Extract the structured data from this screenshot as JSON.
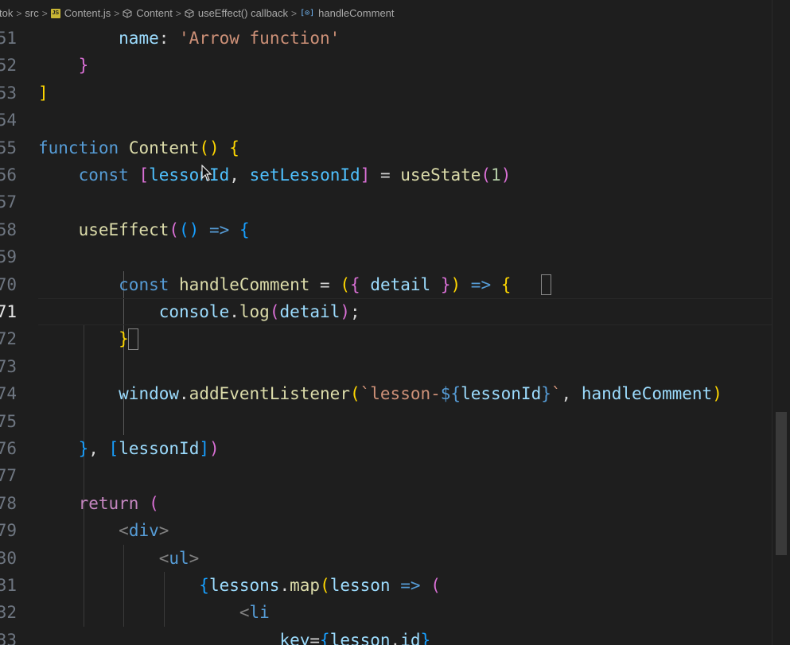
{
  "breadcrumb": [
    {
      "label": "tok",
      "icon": null
    },
    {
      "label": "src",
      "icon": null
    },
    {
      "label": "Content.js",
      "icon": "js-file-icon"
    },
    {
      "label": "Content",
      "icon": "symbol-cube-icon"
    },
    {
      "label": "useEffect() callback",
      "icon": "symbol-cube-icon"
    },
    {
      "label": "handleComment",
      "icon": "symbol-variable-icon"
    }
  ],
  "separator": ">",
  "editor": {
    "active_line": "71",
    "lines": [
      {
        "num": "51",
        "tokens": [
          [
            "pn",
            "        "
          ],
          [
            "var",
            "name"
          ],
          [
            "pn",
            ": "
          ],
          [
            "str",
            "'Arrow function'"
          ]
        ]
      },
      {
        "num": "52",
        "tokens": [
          [
            "pn",
            "    "
          ],
          [
            "b2",
            "}"
          ]
        ]
      },
      {
        "num": "53",
        "tokens": [
          [
            "b1",
            "]"
          ]
        ]
      },
      {
        "num": "54",
        "tokens": []
      },
      {
        "num": "55",
        "tokens": [
          [
            "kw",
            "function"
          ],
          [
            "pn",
            " "
          ],
          [
            "fn",
            "Content"
          ],
          [
            "b1",
            "()"
          ],
          [
            "pn",
            " "
          ],
          [
            "b1",
            "{"
          ]
        ]
      },
      {
        "num": "56",
        "tokens": [
          [
            "pn",
            "    "
          ],
          [
            "kw",
            "const"
          ],
          [
            "pn",
            " "
          ],
          [
            "b2",
            "["
          ],
          [
            "cst",
            "lessonId"
          ],
          [
            "pn",
            ", "
          ],
          [
            "cst",
            "setLessonId"
          ],
          [
            "b2",
            "]"
          ],
          [
            "pn",
            " = "
          ],
          [
            "fn",
            "useState"
          ],
          [
            "b2",
            "("
          ],
          [
            "num",
            "1"
          ],
          [
            "b2",
            ")"
          ]
        ]
      },
      {
        "num": "57",
        "tokens": []
      },
      {
        "num": "58",
        "tokens": [
          [
            "pn",
            "    "
          ],
          [
            "fn",
            "useEffect"
          ],
          [
            "b2",
            "("
          ],
          [
            "b3",
            "()"
          ],
          [
            "pn",
            " "
          ],
          [
            "kw",
            "=>"
          ],
          [
            "pn",
            " "
          ],
          [
            "b3",
            "{"
          ]
        ]
      },
      {
        "num": "59",
        "tokens": []
      },
      {
        "num": "70",
        "tokens": [
          [
            "pn",
            "        "
          ],
          [
            "kw",
            "const"
          ],
          [
            "pn",
            " "
          ],
          [
            "fn",
            "handleComment"
          ],
          [
            "pn",
            " = "
          ],
          [
            "b1",
            "("
          ],
          [
            "b2",
            "{"
          ],
          [
            "pn",
            " "
          ],
          [
            "var",
            "detail"
          ],
          [
            "pn",
            " "
          ],
          [
            "b2",
            "}"
          ],
          [
            "b1",
            ")"
          ],
          [
            "pn",
            " "
          ],
          [
            "kw",
            "=>"
          ],
          [
            "pn",
            " "
          ],
          [
            "b1",
            "{"
          ]
        ]
      },
      {
        "num": "71",
        "tokens": [
          [
            "pn",
            "            "
          ],
          [
            "var",
            "console"
          ],
          [
            "pn",
            "."
          ],
          [
            "fn",
            "log"
          ],
          [
            "b2",
            "("
          ],
          [
            "var",
            "detail"
          ],
          [
            "b2",
            ")"
          ],
          [
            "pn",
            ";"
          ]
        ]
      },
      {
        "num": "72",
        "tokens": [
          [
            "pn",
            "        "
          ],
          [
            "b1",
            "}"
          ]
        ]
      },
      {
        "num": "73",
        "tokens": []
      },
      {
        "num": "74",
        "tokens": [
          [
            "pn",
            "        "
          ],
          [
            "var",
            "window"
          ],
          [
            "pn",
            "."
          ],
          [
            "fn",
            "addEventListener"
          ],
          [
            "b1",
            "("
          ],
          [
            "str",
            "`lesson-"
          ],
          [
            "kw",
            "${"
          ],
          [
            "var",
            "lessonId"
          ],
          [
            "kw",
            "}"
          ],
          [
            "str",
            "`"
          ],
          [
            "pn",
            ", "
          ],
          [
            "var",
            "handleComment"
          ],
          [
            "b1",
            ")"
          ]
        ]
      },
      {
        "num": "75",
        "tokens": []
      },
      {
        "num": "76",
        "tokens": [
          [
            "pn",
            "    "
          ],
          [
            "b3",
            "}"
          ],
          [
            "pn",
            ", "
          ],
          [
            "b3",
            "["
          ],
          [
            "var",
            "lessonId"
          ],
          [
            "b3",
            "]"
          ],
          [
            "b2",
            ")"
          ]
        ]
      },
      {
        "num": "77",
        "tokens": []
      },
      {
        "num": "78",
        "tokens": [
          [
            "pn",
            "    "
          ],
          [
            "kwc",
            "return"
          ],
          [
            "pn",
            " "
          ],
          [
            "b2",
            "("
          ]
        ]
      },
      {
        "num": "79",
        "tokens": [
          [
            "pn",
            "        "
          ],
          [
            "tag",
            "<"
          ],
          [
            "tagn",
            "div"
          ],
          [
            "tag",
            ">"
          ]
        ]
      },
      {
        "num": "30",
        "tokens": [
          [
            "pn",
            "            "
          ],
          [
            "tag",
            "<"
          ],
          [
            "tagn",
            "ul"
          ],
          [
            "tag",
            ">"
          ]
        ]
      },
      {
        "num": "31",
        "tokens": [
          [
            "pn",
            "                "
          ],
          [
            "b3",
            "{"
          ],
          [
            "var",
            "lessons"
          ],
          [
            "pn",
            "."
          ],
          [
            "fn",
            "map"
          ],
          [
            "b1",
            "("
          ],
          [
            "var",
            "lesson"
          ],
          [
            "pn",
            " "
          ],
          [
            "kw",
            "=>"
          ],
          [
            "pn",
            " "
          ],
          [
            "b2",
            "("
          ]
        ]
      },
      {
        "num": "32",
        "tokens": [
          [
            "pn",
            "                    "
          ],
          [
            "tag",
            "<"
          ],
          [
            "tagn",
            "li"
          ]
        ]
      },
      {
        "num": "33",
        "tokens": [
          [
            "pn",
            "                        "
          ],
          [
            "attr",
            "key"
          ],
          [
            "pn",
            "="
          ],
          [
            "b3",
            "{"
          ],
          [
            "var",
            "lesson"
          ],
          [
            "pn",
            "."
          ],
          [
            "var",
            "id"
          ],
          [
            "b3",
            "}"
          ]
        ]
      }
    ]
  }
}
